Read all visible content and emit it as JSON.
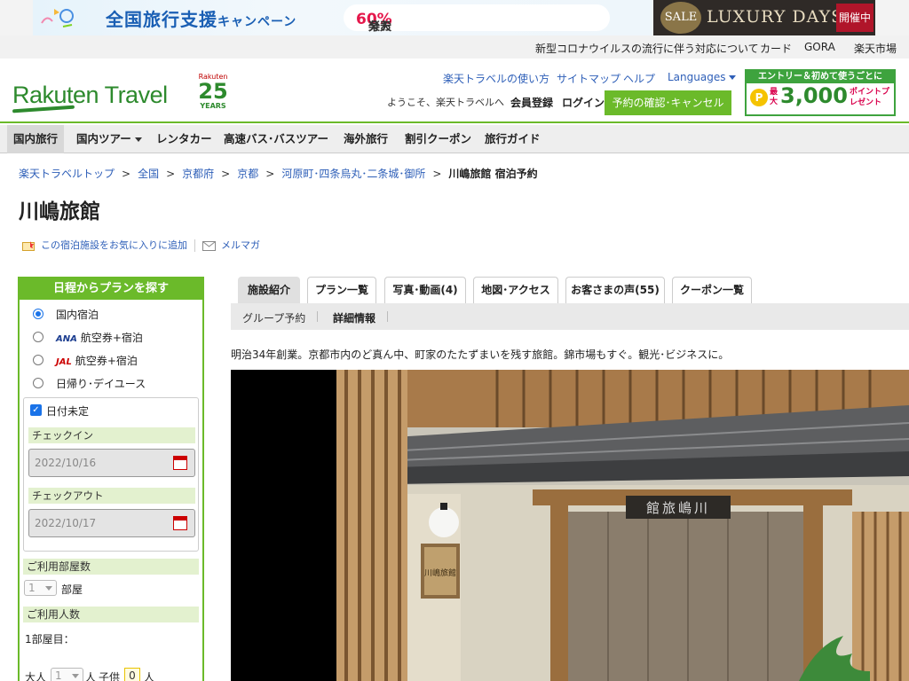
{
  "banner": {
    "campaign": "全国旅行支援",
    "campaign_suffix": "キャンペーン",
    "pill_text": "楽天トラベルなら最大",
    "pill_percent": "60%",
    "pill_suffix": "分お得!",
    "sale": "SALE",
    "luxury": "LUXURY DAYS",
    "kaisai": "開催中"
  },
  "utility": {
    "links": [
      "新型コロナウイルスの流行に伴う対応について",
      "カード",
      "GORA",
      "楽天市場"
    ]
  },
  "header": {
    "logo": "Rakuten Travel",
    "years_brand": "Rakuten",
    "years_number": "25",
    "years_label": "YEARS",
    "links": [
      "楽天トラベルの使い方",
      "サイトマップ",
      "ヘルプ",
      "Languages"
    ],
    "welcome": "ようこそ、楽天トラベルへ",
    "member": "会員登録",
    "login": "ログイン",
    "reserve_button": "予約の確認･キャンセル",
    "entry_top": "エントリー＆初めて使うごとに",
    "entry_coin": "P",
    "entry_pre": "最大",
    "entry_num": "3,000",
    "entry_pt": "ポイントプレゼント"
  },
  "nav": {
    "items": [
      "国内旅行",
      "国内ツアー",
      "レンタカー",
      "高速バス･バスツアー",
      "海外旅行",
      "割引クーポン",
      "旅行ガイド"
    ]
  },
  "breadcrumb": {
    "items": [
      "楽天トラベルトップ",
      "全国",
      "京都府",
      "京都",
      "河原町･四条烏丸･二条城･御所"
    ],
    "current": "川嶋旅館 宿泊予約",
    "separator": ">"
  },
  "page": {
    "title": "川嶋旅館",
    "favorite": "この宿泊施設をお気に入りに追加",
    "mailmag": "メルマガ"
  },
  "search": {
    "heading": "日程からプランを探す",
    "options": [
      "国内宿泊",
      "航空券+宿泊",
      "航空券+宿泊",
      "日帰り･デイユース"
    ],
    "ana": "ANA",
    "jal": "JAL",
    "selected_option": "国内宿泊",
    "date_undecided": "日付未定",
    "date_undecided_checked": true,
    "checkin_label": "チェックイン",
    "checkin_value": "2022/10/16",
    "checkout_label": "チェックアウト",
    "checkout_value": "2022/10/17",
    "rooms_label": "ご利用部屋数",
    "rooms_value": "1",
    "rooms_unit": "部屋",
    "guests_label": "ご利用人数",
    "room1": "1部屋目：",
    "adult_label": "大人",
    "adult_value": "1",
    "adult_unit": "人",
    "child_label": "子供",
    "child_value": "0",
    "child_unit": "人"
  },
  "tabs": {
    "items": [
      "施設紹介",
      "プラン一覧",
      "写真･動画(4)",
      "地図･アクセス",
      "お客さまの声(55)",
      "クーポン一覧"
    ],
    "active": "施設紹介"
  },
  "subtabs": {
    "items": [
      "グループ予約",
      "詳細情報"
    ],
    "active": "詳細情報"
  },
  "content": {
    "description": "明治34年創業。京都市内のど真ん中、町家のたたずまいを残す旅館。錦市場もすぐ。観光･ビジネスに。"
  },
  "photo": {
    "sign_main": "館旅嶋川",
    "sign_small": "川嶋旅館"
  },
  "colors": {
    "brand_green": "#6bba2a",
    "logo_green": "#2d8a2d",
    "link_blue": "#2e5fb8"
  }
}
